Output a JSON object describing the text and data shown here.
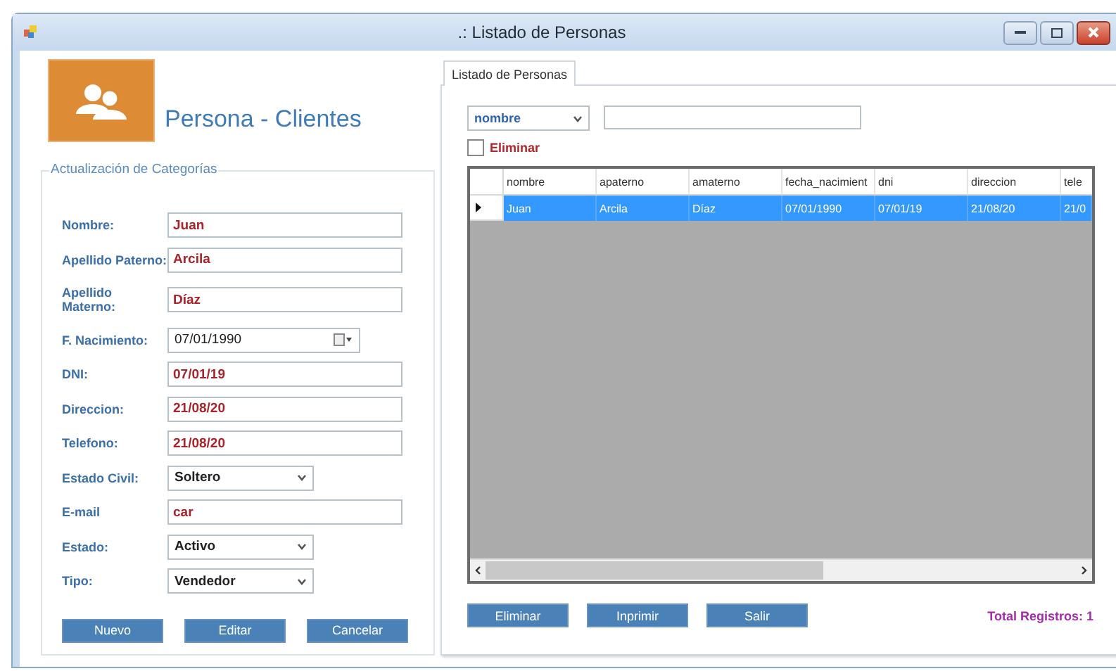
{
  "window": {
    "title": ".: Listado de Personas"
  },
  "header": {
    "title": "Persona - Clientes"
  },
  "form": {
    "group_title": "Actualización de Categorías",
    "fields": [
      {
        "kind": "text",
        "label": "Nombre:",
        "value": "Juan"
      },
      {
        "kind": "text",
        "label": "Apellido Paterno:",
        "value": "Arcila"
      },
      {
        "kind": "text",
        "label": "Apellido Materno:",
        "value": "Díaz"
      },
      {
        "kind": "date",
        "label": "F. Nacimiento:",
        "value": "07/01/1990"
      },
      {
        "kind": "text",
        "label": "DNI:",
        "value": "07/01/19"
      },
      {
        "kind": "text",
        "label": "Direccion:",
        "value": "21/08/20"
      },
      {
        "kind": "text",
        "label": "Telefono:",
        "value": "21/08/20"
      },
      {
        "kind": "select",
        "label": "Estado Civil:",
        "value": "Soltero"
      },
      {
        "kind": "text",
        "label": "E-mail",
        "value": "car"
      },
      {
        "kind": "select",
        "label": "Estado:",
        "value": "Activo"
      },
      {
        "kind": "select",
        "label": "Tipo:",
        "value": "Vendedor"
      }
    ],
    "buttons": [
      "Nuevo",
      "Editar",
      "Cancelar"
    ]
  },
  "tabs": [
    {
      "label": "Listado de Personas",
      "selected": true
    }
  ],
  "search": {
    "field": "nombre"
  },
  "delete_checkbox": {
    "label": "Eliminar",
    "checked": false
  },
  "table": {
    "columns": [
      "nombre",
      "apaterno",
      "amaterno",
      "fecha_nacimient",
      "dni",
      "direccion",
      "tele"
    ],
    "rows": [
      {
        "selected": true,
        "cells": [
          "Juan",
          "Arcila",
          "Díaz",
          "07/01/1990",
          "07/01/19",
          "21/08/20",
          "21/0"
        ]
      }
    ]
  },
  "list_buttons": [
    "Eliminar",
    "Inprimir",
    "Salir"
  ],
  "total": "Total Registros: 1"
}
